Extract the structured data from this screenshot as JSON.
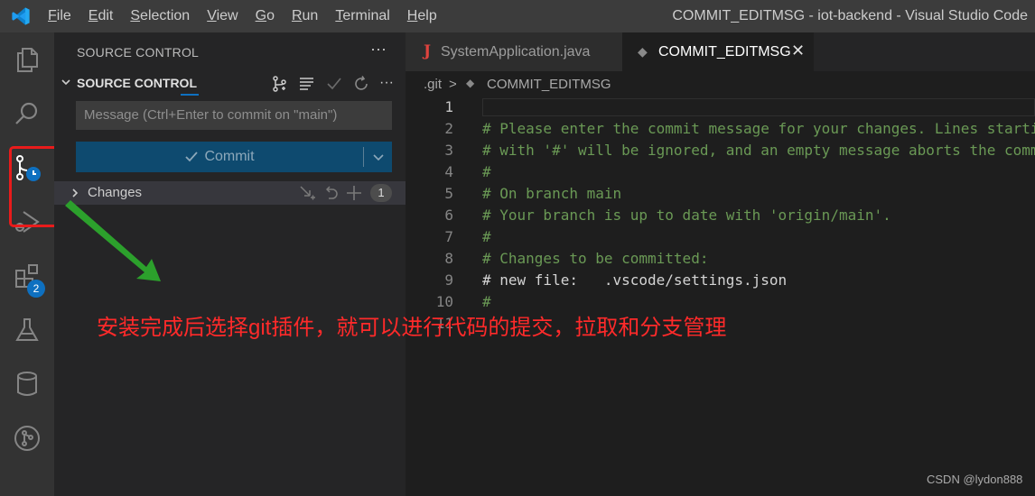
{
  "titlebar": {
    "menu": [
      "File",
      "Edit",
      "Selection",
      "View",
      "Go",
      "Run",
      "Terminal",
      "Help"
    ],
    "window_title": "COMMIT_EDITMSG - iot-backend - Visual Studio Code"
  },
  "activity_bar": {
    "extensions_badge": "2"
  },
  "sidebar": {
    "title": "SOURCE CONTROL",
    "more": "···",
    "section_label": "SOURCE CONTROL",
    "message_placeholder": "Message (Ctrl+Enter to commit on \"main\")",
    "commit_label": "Commit",
    "changes_label": "Changes",
    "changes_count": "1"
  },
  "tabs": [
    {
      "label": "SystemApplication.java",
      "icon": "java-icon"
    },
    {
      "label": "COMMIT_EDITMSG",
      "icon": "git-icon",
      "close": "✕"
    }
  ],
  "breadcrumb": {
    "folder": ".git",
    "separator": ">",
    "file": "COMMIT_EDITMSG"
  },
  "editor": {
    "line_numbers": [
      "1",
      "2",
      "3",
      "4",
      "5",
      "6",
      "7",
      "8",
      "9",
      "10",
      "11"
    ],
    "lines": [
      "",
      "# Please enter the commit message for your changes. Lines starting",
      "# with '#' will be ignored, and an empty message aborts the commit.",
      "#",
      "# On branch main",
      "# Your branch is up to date with 'origin/main'.",
      "#",
      "# Changes to be committed:",
      "#\tnew file:   .vscode/settings.json",
      "#",
      ""
    ]
  },
  "annotation": {
    "text": "安装完成后选择git插件，就可以进行代码的提交，拉取和分支管理",
    "color": "#ff2a2a"
  },
  "watermark": "CSDN @lydon888",
  "colors": {
    "accent": "#0e70c0",
    "highlight_box": "#e81b1b",
    "arrow": "#2ca02c",
    "comment": "#6a9955"
  }
}
